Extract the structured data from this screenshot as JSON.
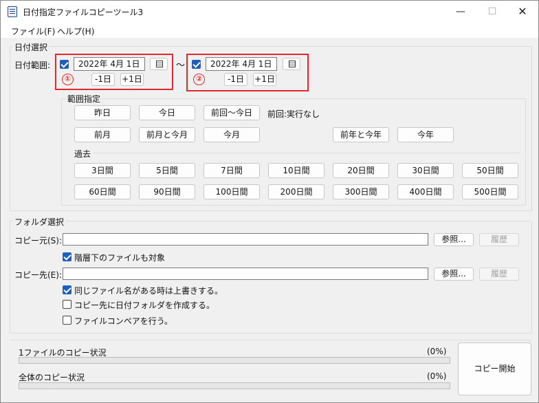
{
  "window": {
    "title": "日付指定ファイルコピーツール3",
    "min_glyph": "—",
    "max_glyph": "☐",
    "close_glyph": "✕"
  },
  "menu": [
    "ファイル(F)",
    "ヘルプ(H)"
  ],
  "date_section": {
    "label": "日付選択",
    "range_label": "日付範囲:",
    "tilde": "～",
    "from": {
      "checked": true,
      "value": "2022年  4月  1日",
      "minus": "-1日",
      "plus": "+1日",
      "marker": "①"
    },
    "to": {
      "checked": true,
      "value": "2022年  4月  1日",
      "minus": "-1日",
      "plus": "+1日",
      "marker": "②"
    },
    "annotation_color": "#e5262d"
  },
  "range_spec": {
    "label": "範囲指定",
    "row1": [
      "昨日",
      "今日",
      "前回～今日"
    ],
    "last_run": "前回:実行なし",
    "row2": [
      "前月",
      "前月と今月",
      "今月",
      "前年と今年",
      "今年"
    ],
    "past_label": "過去",
    "past_row1": [
      "3日間",
      "5日間",
      "7日間",
      "10日間",
      "20日間",
      "30日間",
      "50日間"
    ],
    "past_row2": [
      "60日間",
      "90日間",
      "100日間",
      "200日間",
      "300日間",
      "400日間",
      "500日間"
    ]
  },
  "folder_section": {
    "label": "フォルダ選択",
    "source_label": "コピー元(S):",
    "source_value": "",
    "browse": "参照...",
    "history": "履歴",
    "include_sub": {
      "checked": true,
      "label": "階層下のファイルも対象"
    },
    "dest_label": "コピー先(E):",
    "dest_value": "",
    "overwrite": {
      "checked": true,
      "label": "同じファイル名がある時は上書きする。"
    },
    "make_date_folder": {
      "checked": false,
      "label": "コピー先に日付フォルダを作成する。"
    },
    "compare": {
      "checked": false,
      "label": "ファイルコンペアを行う。"
    }
  },
  "status": {
    "file_label": "1ファイルのコピー状況",
    "file_pct": "(0%)",
    "file_progress": 0,
    "total_label": "全体のコピー状況",
    "total_pct": "(0%)",
    "total_progress": 0,
    "start_button": "コピー開始"
  }
}
